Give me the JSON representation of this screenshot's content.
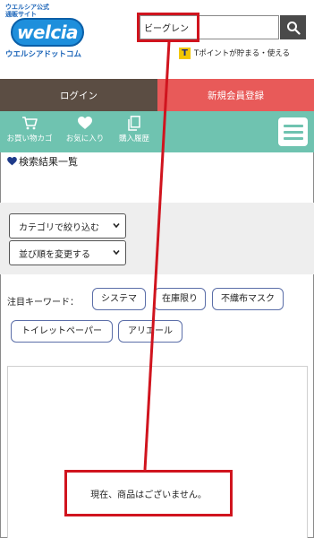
{
  "header": {
    "logo_tagline_1": "ウエルシア公式",
    "logo_tagline_2": "通販サイト",
    "logo_word": "welcia",
    "logo_sub": "ウエルシアドットコム",
    "search_value": "ビーグレン",
    "tpoint_mark": "T",
    "tpoint_text": "Tポイントが貯まる・使える"
  },
  "auth": {
    "login": "ログイン",
    "register": "新規会員登録"
  },
  "nav": {
    "items": [
      {
        "label": "お買い物カゴ",
        "icon": "cart-icon"
      },
      {
        "label": "お気に入り",
        "icon": "heart-icon"
      },
      {
        "label": "購入履歴",
        "icon": "history-icon"
      }
    ],
    "menu_icon": "hamburger-menu-icon"
  },
  "page": {
    "heading": "検索結果一覧"
  },
  "filters": {
    "category": "カテゴリで絞り込む",
    "sort": "並び順を変更する"
  },
  "keywords": {
    "label": "注目キーワード：",
    "items": [
      "システマ",
      "在庫限り",
      "不織布マスク",
      "トイレットペーパー",
      "アリエール"
    ]
  },
  "results": {
    "empty_message": "現在、商品はございません。"
  },
  "colors": {
    "login_bg": "#5b4d43",
    "register_bg": "#e85a59",
    "nav_bg": "#6fc3b0",
    "chip_border": "#5b6ea8",
    "annotation_red": "#d0141e"
  }
}
